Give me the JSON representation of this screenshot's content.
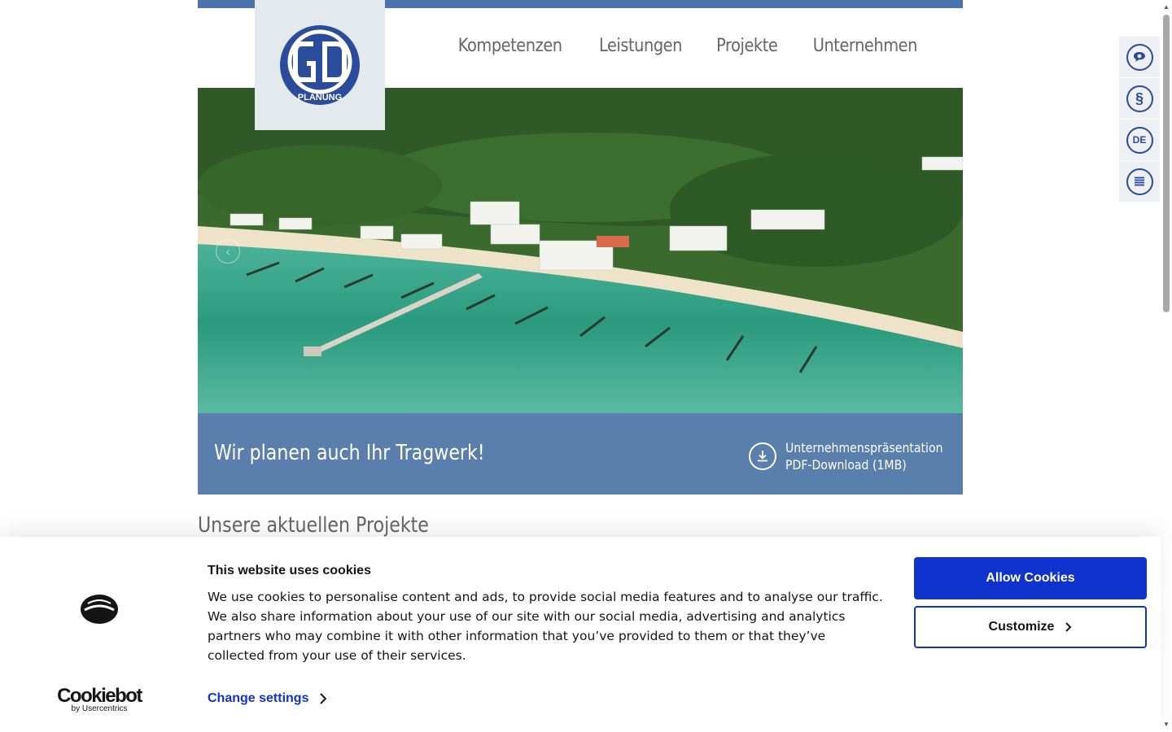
{
  "header": {
    "logo_text": "PLANUNG",
    "logo_initials": "GD",
    "nav": [
      "Kompetenzen",
      "Leistungen",
      "Projekte",
      "Unternehmen"
    ]
  },
  "hero": {
    "prev_icon": "chevron-left-icon"
  },
  "banner": {
    "title": "Wir planen auch Ihr Tragwerk!",
    "download_line1": "Unternehmenspräsentation",
    "download_line2": "PDF-Download (1MB)"
  },
  "section": {
    "title": "Unsere aktuellen Projekte"
  },
  "side_tools": [
    {
      "icon": "chat-icon",
      "label": ""
    },
    {
      "icon": "paragraph-icon",
      "label": "§"
    },
    {
      "icon": "language-icon",
      "label": "DE"
    },
    {
      "icon": "menu-icon",
      "label": ""
    }
  ],
  "cookie": {
    "heading": "This website uses cookies",
    "body": "We use cookies to personalise content and ads, to provide social media features and to analyse our traffic. We also share information about your use of our site with our social media, advertising and analytics partners who may combine it with other information that you’ve provided to them or that they’ve collected from your use of their services.",
    "change_settings": "Change settings",
    "allow": "Allow Cookies",
    "customize": "Customize",
    "brand_name": "Cookiebot",
    "brand_sub": "by Usercentrics"
  },
  "colors": {
    "accent": "#4a72ad",
    "banner": "#5a7fac",
    "logo_blue": "#2b4c9b",
    "cookie_blue": "#1032cf"
  }
}
